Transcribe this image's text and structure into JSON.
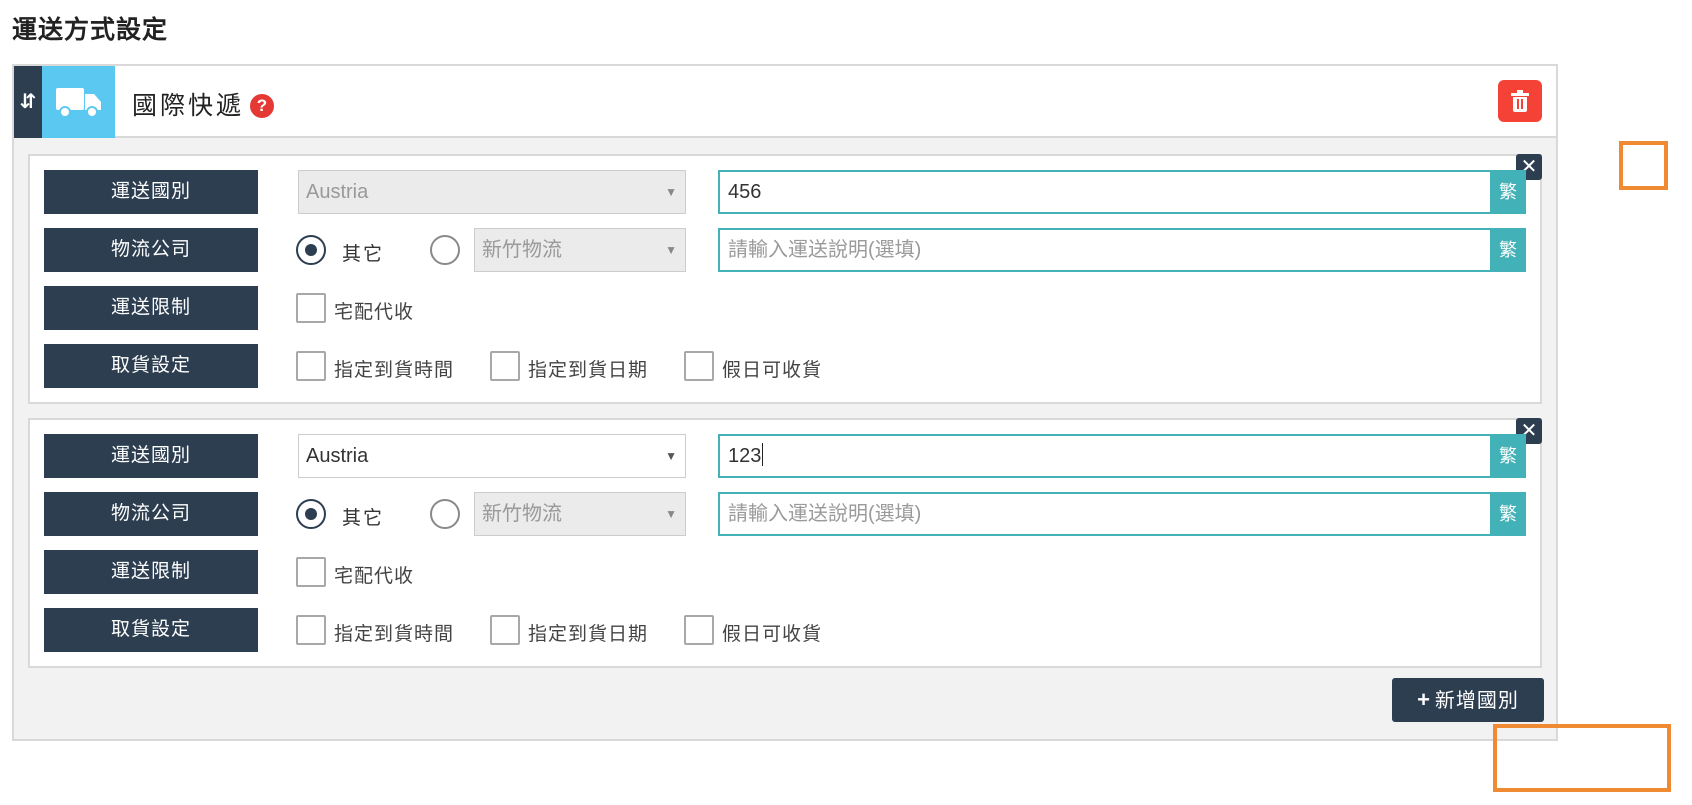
{
  "page": {
    "title": "運送方式設定"
  },
  "method": {
    "name": "國際快遞",
    "sort_handle_glyph": "⇵",
    "help_glyph": "?",
    "icons": {
      "sort": "sort-arrows-icon",
      "truck": "truck-icon",
      "help": "question-circle-icon",
      "delete": "trash-icon"
    }
  },
  "colors": {
    "accent": "#2c3e50",
    "teal": "#42b2b8",
    "danger": "#f44336",
    "truck_tile": "#5bc8f2",
    "highlight": "#f08a32"
  },
  "rules": [
    {
      "remove_glyph": "✕",
      "labels": {
        "country": "運送國別",
        "logistics": "物流公司",
        "restriction": "運送限制",
        "pickup": "取貨設定"
      },
      "country": {
        "value": "Austria",
        "disabled": true
      },
      "fee_input": {
        "value": "456",
        "lang": "繁"
      },
      "logistics": {
        "option_other": "其它",
        "other_checked": true,
        "select_value": "新竹物流",
        "select_disabled": true
      },
      "description_input": {
        "placeholder": "請輸入運送說明(選填)",
        "lang": "繁"
      },
      "restriction": {
        "cod_label": "宅配代收",
        "cod_checked": false
      },
      "pickup": {
        "time_label": "指定到貨時間",
        "date_label": "指定到貨日期",
        "holiday_label": "假日可收貨"
      }
    },
    {
      "remove_glyph": "✕",
      "labels": {
        "country": "運送國別",
        "logistics": "物流公司",
        "restriction": "運送限制",
        "pickup": "取貨設定"
      },
      "country": {
        "value": "Austria",
        "disabled": false
      },
      "fee_input": {
        "value": "123",
        "lang": "繁"
      },
      "logistics": {
        "option_other": "其它",
        "other_checked": true,
        "select_value": "新竹物流",
        "select_disabled": true
      },
      "description_input": {
        "placeholder": "請輸入運送說明(選填)",
        "lang": "繁"
      },
      "restriction": {
        "cod_label": "宅配代收",
        "cod_checked": false
      },
      "pickup": {
        "time_label": "指定到貨時間",
        "date_label": "指定到貨日期",
        "holiday_label": "假日可收貨"
      }
    }
  ],
  "add_country_button": {
    "plus": "+",
    "label": "新增國別"
  }
}
